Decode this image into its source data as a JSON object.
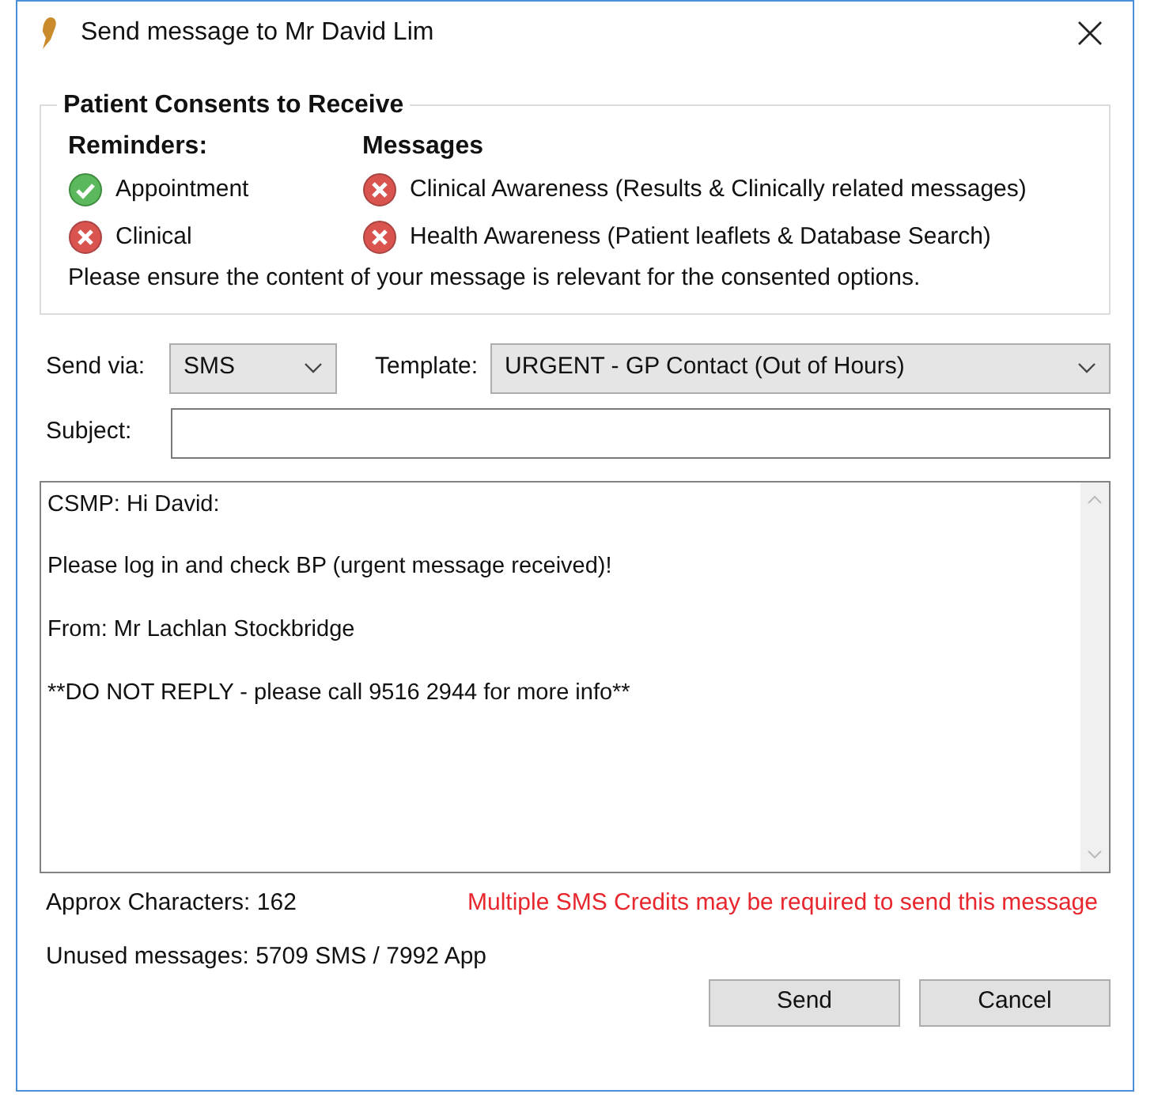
{
  "window": {
    "title": "Send message to Mr David Lim"
  },
  "consents": {
    "title": "Patient Consents to Receive",
    "reminders": {
      "heading": "Reminders:",
      "items": [
        {
          "label": "Appointment",
          "consented": true
        },
        {
          "label": "Clinical",
          "consented": false
        }
      ]
    },
    "messages": {
      "heading": "Messages",
      "items": [
        {
          "label": "Clinical Awareness (Results & Clinically related messages)",
          "consented": false
        },
        {
          "label": "Health Awareness (Patient leaflets & Database Search)",
          "consented": false
        }
      ]
    },
    "note": "Please ensure the content of your message is relevant for the consented options."
  },
  "send_via": {
    "label": "Send via:",
    "value": "SMS"
  },
  "template": {
    "label": "Template:",
    "value": "URGENT - GP Contact (Out of Hours)"
  },
  "subject": {
    "label": "Subject:"
  },
  "body": [
    "CSMP: Hi David:",
    "Please log in and check BP (urgent message received)!",
    "From: Mr Lachlan Stockbridge",
    "**DO NOT REPLY - please call 9516 2944 for more info**"
  ],
  "approx": {
    "label": "Approx Characters:",
    "value": "162"
  },
  "warning": "Multiple SMS Credits may be required to send this message",
  "unused": {
    "label": "Unused messages:",
    "value": "5709 SMS / 7992 App"
  },
  "buttons": [
    "Send",
    "Cancel"
  ]
}
